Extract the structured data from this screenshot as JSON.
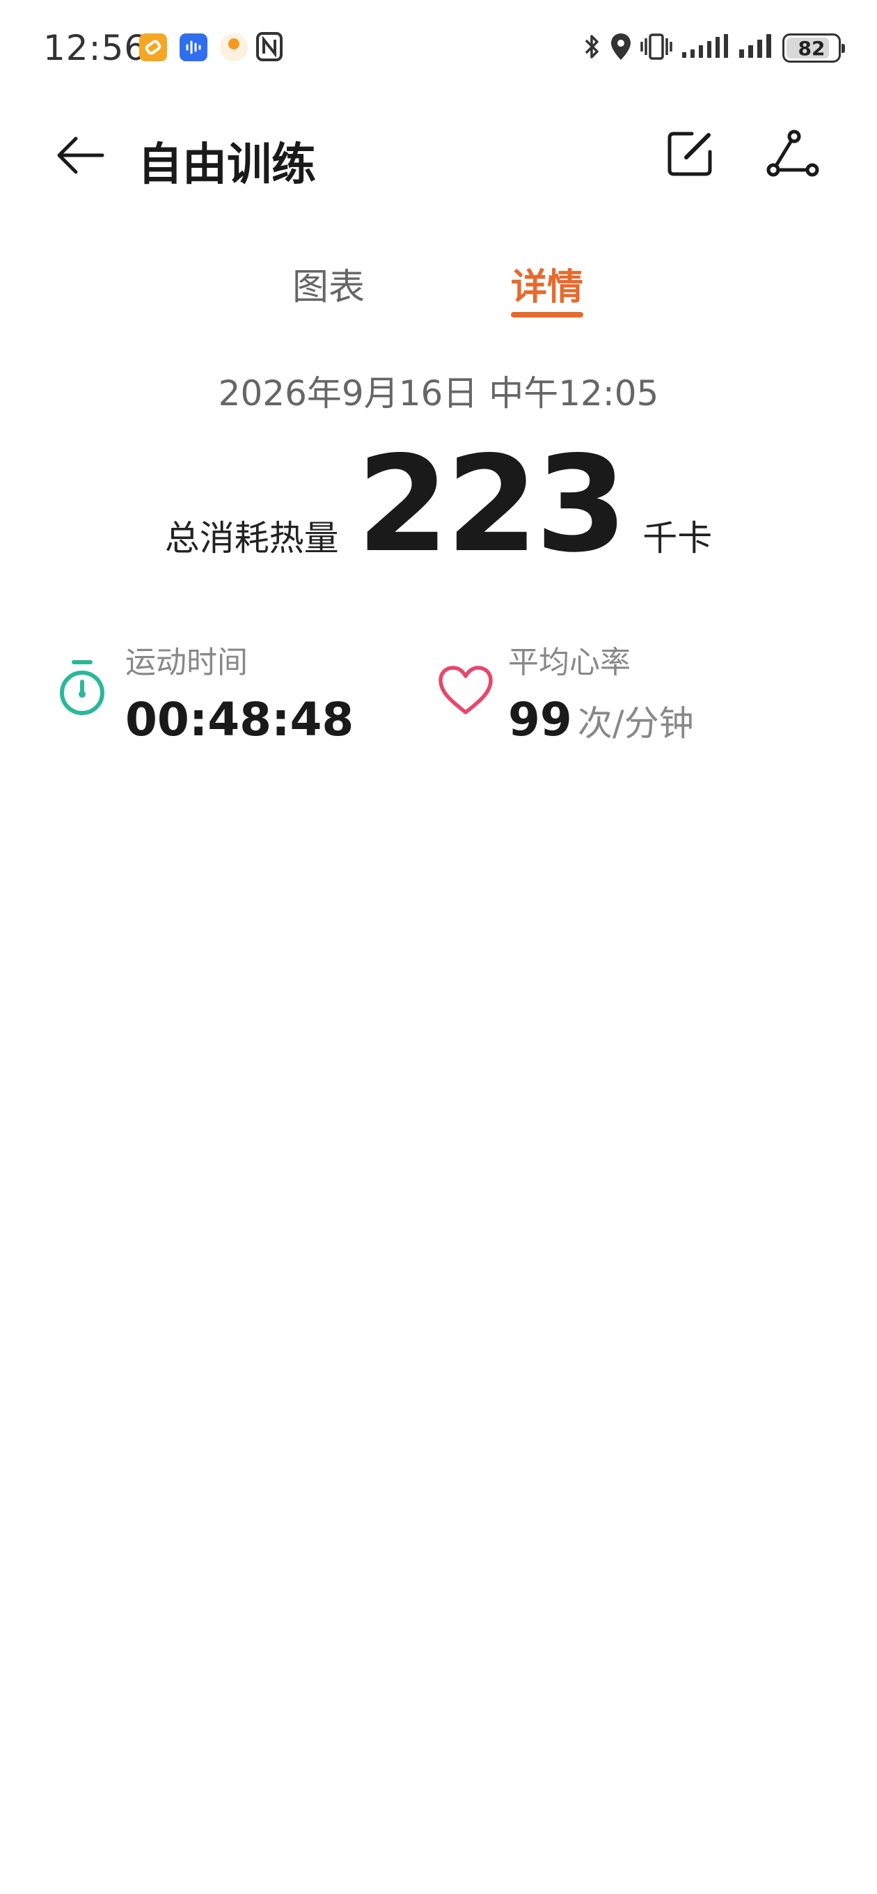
{
  "status_bar": {
    "time": "12:56",
    "battery_level": "82",
    "icons": [
      "app-icon-orange",
      "voice-app-icon",
      "app-icon-circle",
      "nfc-icon",
      "bluetooth-icon",
      "location-icon",
      "vibrate-icon",
      "signal-icon",
      "signal-icon",
      "battery-icon"
    ]
  },
  "header": {
    "title": "自由训练",
    "icons": [
      "back-arrow-icon",
      "edit-icon",
      "share-route-icon"
    ]
  },
  "tabs": [
    {
      "label": "图表",
      "active": false
    },
    {
      "label": "详情",
      "active": true
    }
  ],
  "summary": {
    "datetime": "2026年9月16日 中午12:05",
    "calorie_label": "总消耗热量",
    "calorie_value": "223",
    "calorie_unit": "千卡"
  },
  "metrics": {
    "duration": {
      "label": "运动时间",
      "value": "00:48:48",
      "icon": "stopwatch-icon"
    },
    "heart_rate": {
      "label": "平均心率",
      "value": "99",
      "unit": "次/分钟",
      "icon": "heart-icon"
    }
  },
  "colors": {
    "accent": "#e8692c",
    "timer_icon": "#2bb89a",
    "heart_icon": "#e8476a"
  }
}
